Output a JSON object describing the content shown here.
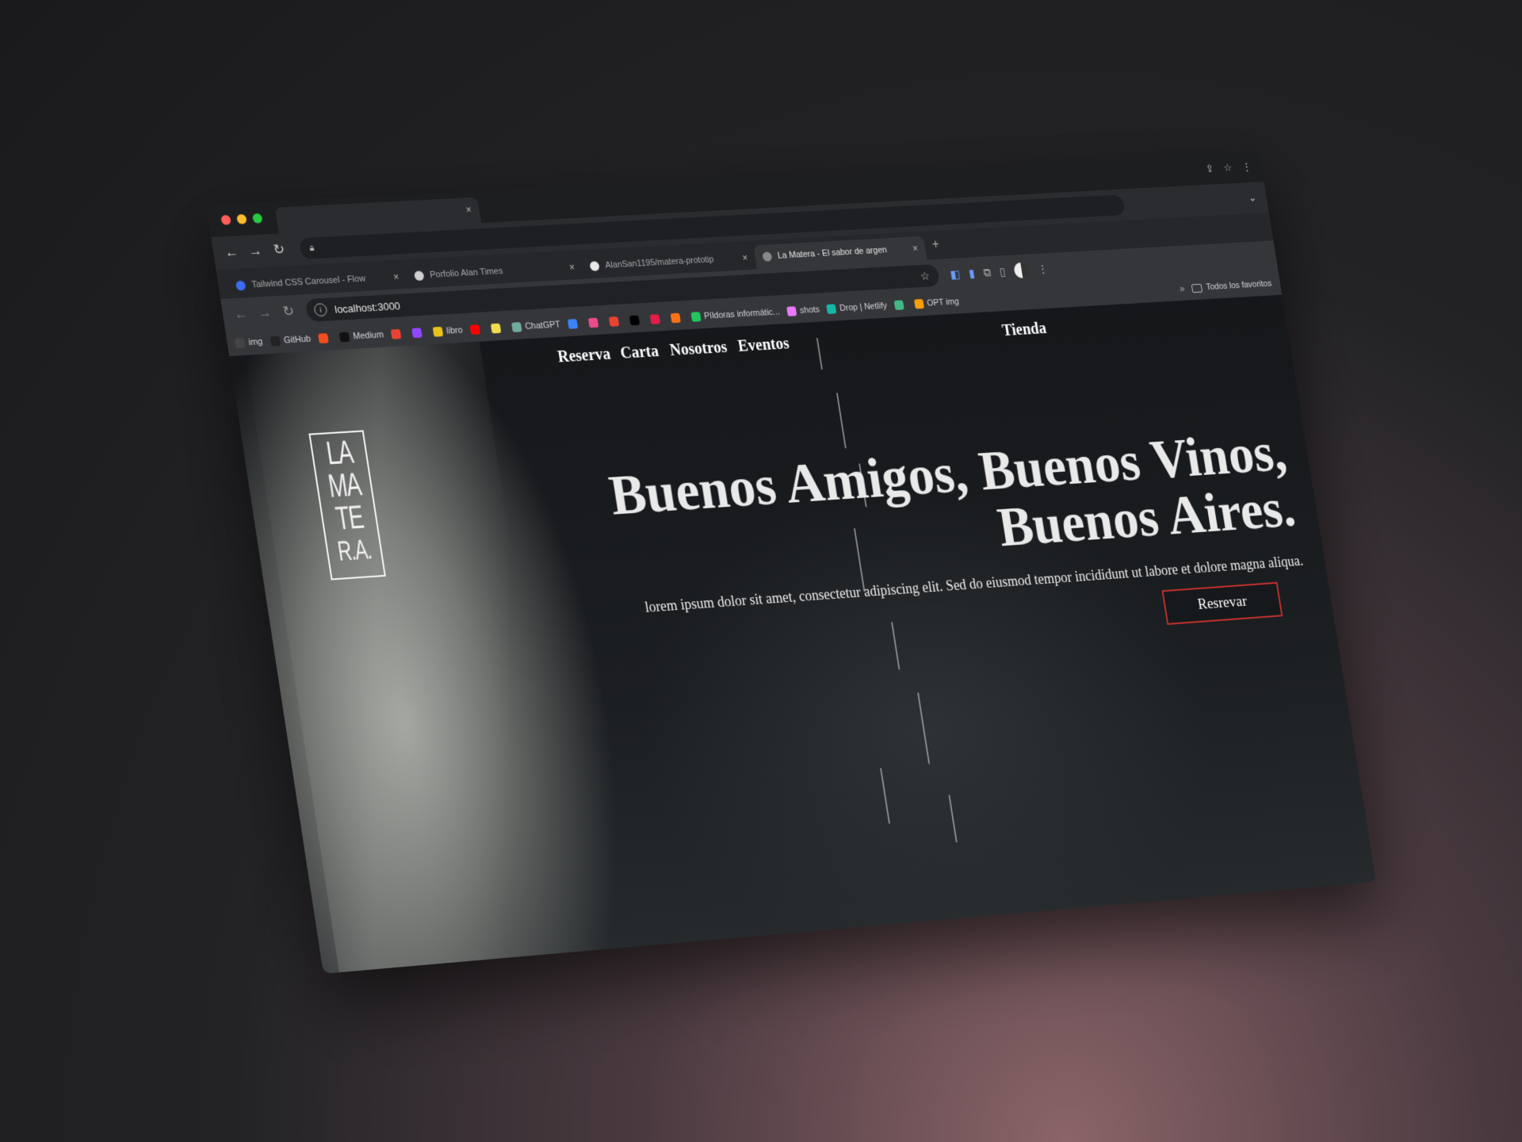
{
  "browser": {
    "window_tab_close": "×",
    "inner_tabs": [
      {
        "title": "Tailwind CSS Carousel - Flow",
        "favicon": "flowbite-icon",
        "color": "#3b6cf2",
        "active": false
      },
      {
        "title": "Porfolio Alan Times",
        "favicon": "a-logo-icon",
        "color": "#cfcfcf",
        "active": false
      },
      {
        "title": "AlanSan1195/matera-prototip",
        "favicon": "github-icon",
        "color": "#e8e8e8",
        "active": false
      },
      {
        "title": "La Matera - El sabor de argen",
        "favicon": "matera-icon",
        "color": "#888888",
        "active": true
      }
    ],
    "tab_close": "×",
    "new_tab": "+",
    "address": "localhost:3000",
    "bookmarks": [
      {
        "label": "img",
        "icon": "img-icon",
        "color": "#444444"
      },
      {
        "label": "GitHub",
        "icon": "github-icon",
        "color": "#222222"
      },
      {
        "label": "",
        "icon": "figma-icon",
        "color": "#f24e1e"
      },
      {
        "label": "Medium",
        "icon": "medium-icon",
        "color": "#111111"
      },
      {
        "label": "",
        "icon": "gmail-icon",
        "color": "#ea4335"
      },
      {
        "label": "",
        "icon": "twitch-icon",
        "color": "#9146ff"
      },
      {
        "label": "libro",
        "icon": "js-book-icon",
        "color": "#e8c21a"
      },
      {
        "label": "",
        "icon": "youtube-icon",
        "color": "#ff0000"
      },
      {
        "label": "",
        "icon": "js-icon",
        "color": "#f0db4f"
      },
      {
        "label": "ChatGPT",
        "icon": "chatgpt-icon",
        "color": "#74aa9c"
      },
      {
        "label": "",
        "icon": "vercel-icon",
        "color": "#3b82f6"
      },
      {
        "label": "",
        "icon": "dribbble-icon",
        "color": "#ea4c89"
      },
      {
        "label": "",
        "icon": "gmail-icon",
        "color": "#ea4335"
      },
      {
        "label": "",
        "icon": "x-icon",
        "color": "#000000"
      },
      {
        "label": "",
        "icon": "record-icon",
        "color": "#e11d48"
      },
      {
        "label": "",
        "icon": "orange-app-icon",
        "color": "#f97316"
      },
      {
        "label": "Píldoras informátic...",
        "icon": "pildoras-icon",
        "color": "#22c55e"
      },
      {
        "label": "shots",
        "icon": "shots-icon",
        "color": "#e879f9"
      },
      {
        "label": "Drop | Netlify",
        "icon": "netlify-icon",
        "color": "#14b8a6"
      },
      {
        "label": "",
        "icon": "vue-icon",
        "color": "#42b883"
      },
      {
        "label": "OPT img",
        "icon": "opt-icon",
        "color": "#f59e0b"
      }
    ],
    "bookmarks_more": "»",
    "all_bookmarks": "Todos los favoritos"
  },
  "site": {
    "nav": [
      "Reserva",
      "Carta",
      "Nosotros",
      "Eventos"
    ],
    "shop": "Tienda",
    "logo_lines": [
      "LA",
      "MA",
      "TE",
      "R.A."
    ],
    "headline_1": "Buenos Amigos, Buenos Vinos,",
    "headline_2": "Buenos Aires.",
    "subtitle": "lorem ipsum dolor sit amet, consectetur adipiscing elit. Sed do eiusmod tempor incididunt ut labore et dolore magna aliqua.",
    "cta": "Resrevar"
  },
  "colors": {
    "cta_border": "#c0302f",
    "traffic_red": "#ff5f57",
    "traffic_yellow": "#febc2e",
    "traffic_green": "#28c840"
  }
}
